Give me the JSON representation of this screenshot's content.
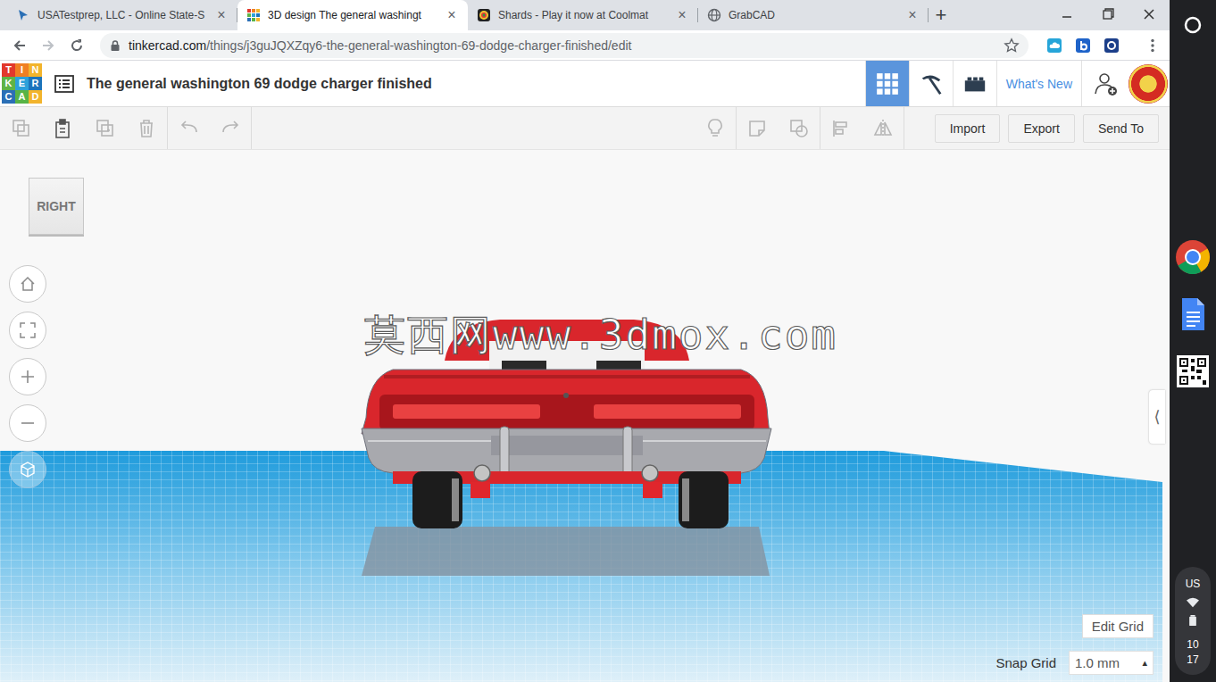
{
  "browser": {
    "tabs": [
      {
        "label": "USATestprep, LLC - Online State-S",
        "selected": false,
        "close": "×"
      },
      {
        "label": "3D design The general washingt",
        "selected": true,
        "close": "×"
      },
      {
        "label": "Shards - Play it now at Coolmat",
        "selected": false,
        "close": "×"
      },
      {
        "label": "GrabCAD",
        "selected": false,
        "close": "×"
      }
    ],
    "new_tab": "+",
    "address": {
      "host": "tinkercad.com",
      "path": "/things/j3guJQXZqy6-the-general-washington-69-dodge-charger-finished/edit"
    }
  },
  "app": {
    "logo": [
      "T",
      "I",
      "N",
      "K",
      "E",
      "R",
      "C",
      "A",
      "D"
    ],
    "title": "The general washington 69 dodge charger finished",
    "view_modes": [
      {
        "selected": true
      },
      {
        "selected": false
      },
      {
        "selected": false
      }
    ],
    "whats_new": "What's New"
  },
  "toolbar": {
    "edit_tools": [
      {
        "disabled": true
      },
      {
        "disabled": false
      },
      {
        "disabled": true
      },
      {
        "disabled": true
      },
      {
        "disabled": true
      },
      {
        "disabled": true
      }
    ],
    "shape_tools": [
      {
        "disabled": true
      },
      {
        "disabled": true
      },
      {
        "disabled": true
      },
      {
        "disabled": true
      },
      {
        "disabled": true
      }
    ],
    "buttons": [
      "Import",
      "Export",
      "Send To"
    ]
  },
  "canvas": {
    "view_cube": "RIGHT",
    "watermark": "莫西网www.3dmox.com",
    "collapse": "⟨",
    "edit_grid": "Edit Grid",
    "snap_grid": {
      "label": "Snap Grid",
      "value": "1.0 mm",
      "arrow": "▴"
    }
  },
  "shelf": {
    "locale": "US",
    "hours": "10",
    "minutes": "17"
  }
}
